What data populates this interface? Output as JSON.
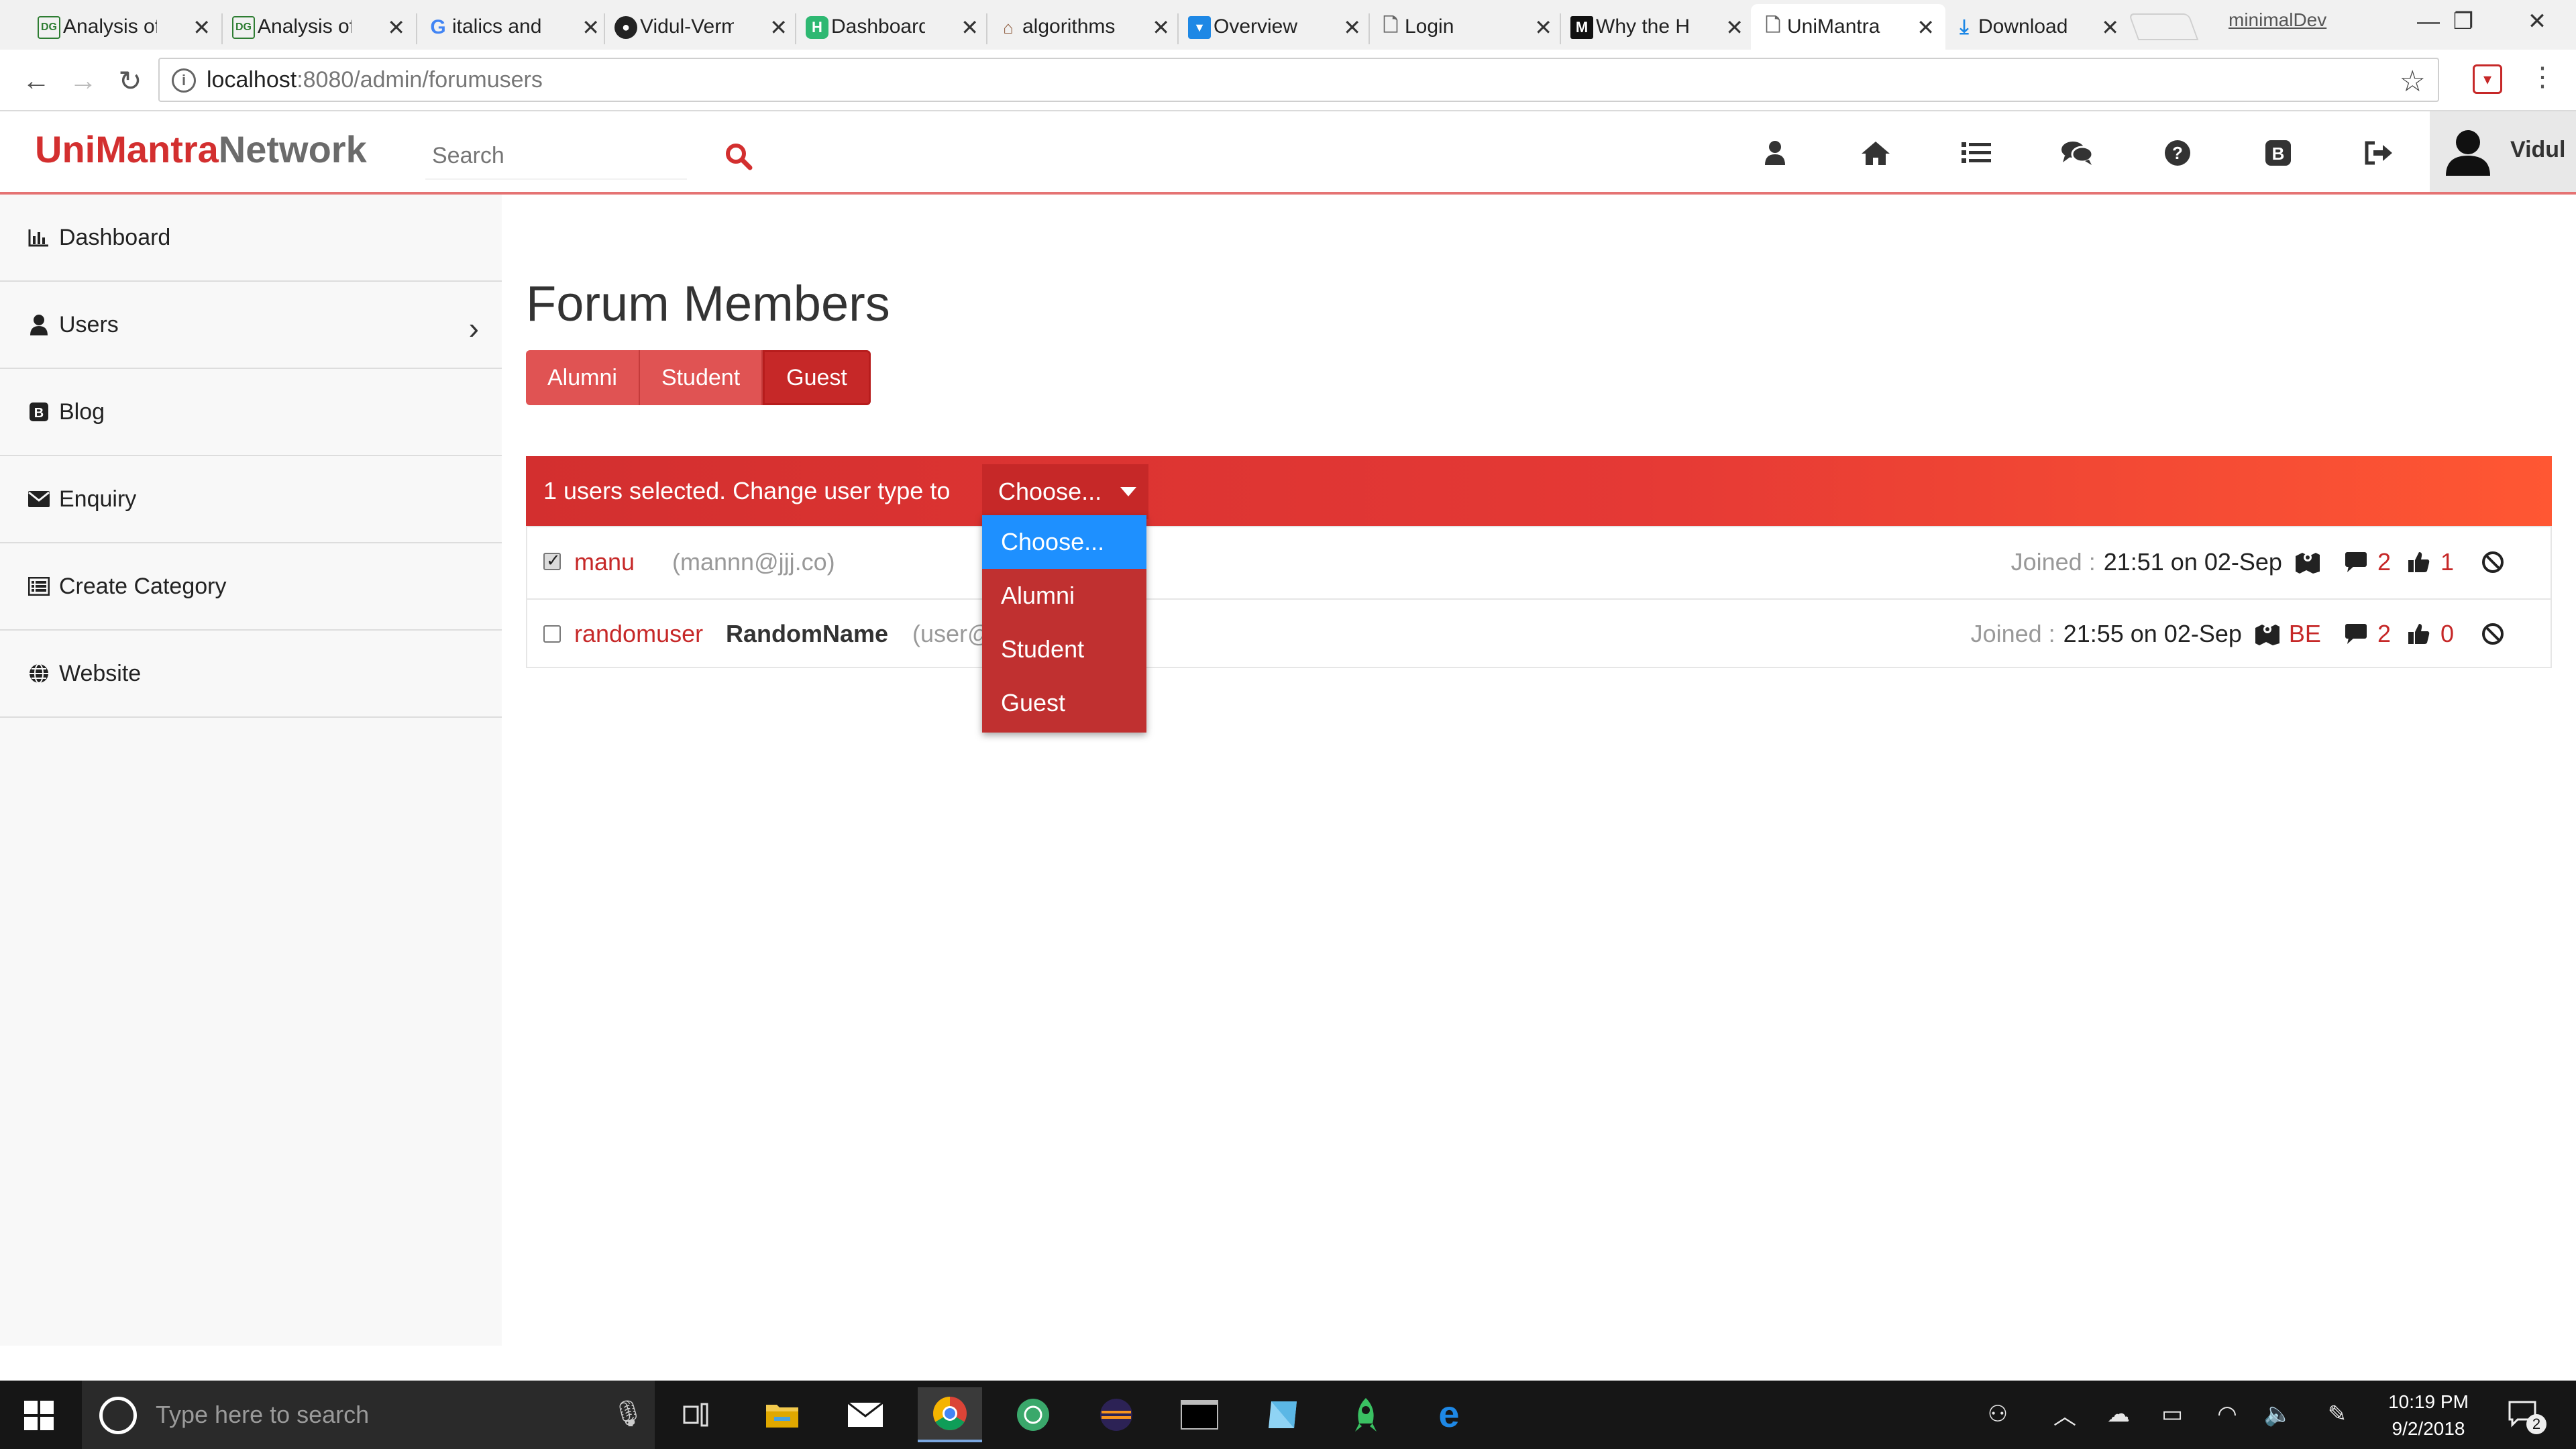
{
  "browser": {
    "tabs": [
      {
        "label": "Analysis of",
        "icon": "dg-icon"
      },
      {
        "label": "Analysis of",
        "icon": "dg-icon"
      },
      {
        "label": "italics and",
        "icon": "google-icon"
      },
      {
        "label": "Vidul-Verm",
        "icon": "github-icon"
      },
      {
        "label": "Dashboard",
        "icon": "h-icon"
      },
      {
        "label": "algorithms",
        "icon": "stackexchange-icon"
      },
      {
        "label": "Overview",
        "icon": "shield-icon"
      },
      {
        "label": "Login",
        "icon": "page-icon"
      },
      {
        "label": "Why the H",
        "icon": "medium-icon"
      },
      {
        "label": "UniMantra",
        "icon": "page-icon",
        "active": true
      },
      {
        "label": "Download",
        "icon": "download-icon"
      }
    ],
    "profile_label": "minimalDev",
    "url_host": "localhost",
    "url_rest": ":8080/admin/forumusers"
  },
  "header": {
    "brand_part1": "UniMantra",
    "brand_part2": "Network",
    "search_placeholder": "Search",
    "user_name": "Vidul"
  },
  "sidebar": {
    "items": [
      {
        "label": "Dashboard",
        "icon": "bar-chart-icon"
      },
      {
        "label": "Users",
        "icon": "user-icon"
      },
      {
        "label": "Blog",
        "icon": "blogger-icon"
      },
      {
        "label": "Enquiry",
        "icon": "envelope-icon"
      },
      {
        "label": "Create Category",
        "icon": "list-icon"
      },
      {
        "label": "Website",
        "icon": "globe-icon"
      }
    ]
  },
  "main": {
    "title": "Forum Members",
    "filters": [
      "Alumni",
      "Student",
      "Guest"
    ],
    "bulk_text": "1 users selected. Change user type to",
    "select_value": "Choose...",
    "dropdown_options": [
      "Choose...",
      "Alumni",
      "Student",
      "Guest"
    ],
    "users": [
      {
        "username": "manu",
        "fullname": "",
        "email": "(mannn@jjj.co)",
        "checked": true,
        "joined_label": "Joined :",
        "joined_time": "21:51 on 02-Sep",
        "dept": "",
        "comments": "2",
        "likes": "1"
      },
      {
        "username": "randomuser",
        "fullname": "RandomName",
        "email": "(user@",
        "checked": false,
        "joined_label": "Joined :",
        "joined_time": "21:55 on 02-Sep",
        "dept": "BE",
        "comments": "2",
        "likes": "0"
      }
    ]
  },
  "taskbar": {
    "search_placeholder": "Type here to search",
    "time": "10:19 PM",
    "date": "9/2/2018",
    "notifications": "2"
  },
  "colors": {
    "brand_red": "#d32f2f",
    "dropdown_bg": "#c03030",
    "highlight_blue": "#1e90ff"
  }
}
